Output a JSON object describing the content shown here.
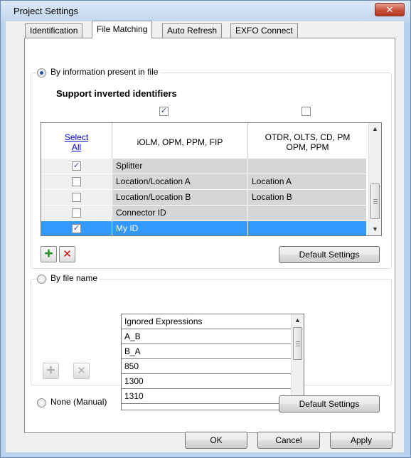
{
  "window": {
    "title": "Project Settings",
    "close_glyph": "✕"
  },
  "tabs": [
    {
      "label": "Identification",
      "active": false
    },
    {
      "label": "File Matching",
      "active": true
    },
    {
      "label": "Auto Refresh",
      "active": false
    },
    {
      "label": "EXFO Connect",
      "active": false
    }
  ],
  "by_info": {
    "label": "By information present in file",
    "selected": true,
    "support_inverted_label": "Support inverted identifiers",
    "support_inverted_col1_checked": true,
    "support_inverted_col2_checked": false
  },
  "grid": {
    "headers": {
      "select": "Select",
      "all": "All",
      "col1": "iOLM, OPM, PPM, FIP",
      "col2_line1": "OTDR, OLTS, CD, PM",
      "col2_line2": "OPM, PPM"
    },
    "rows": [
      {
        "checked": true,
        "col1": "Splitter",
        "col2": "",
        "selected": false
      },
      {
        "checked": false,
        "col1": "Location/Location A",
        "col2": "Location A",
        "selected": false
      },
      {
        "checked": false,
        "col1": "Location/Location B",
        "col2": "Location B",
        "selected": false
      },
      {
        "checked": false,
        "col1": "Connector ID",
        "col2": "",
        "selected": false
      },
      {
        "checked": true,
        "col1": "My ID",
        "col2": "",
        "selected": true
      }
    ],
    "scroll_up_glyph": "▲",
    "scroll_down_glyph": "▼"
  },
  "icons": {
    "add": "+",
    "remove": "✕",
    "check": "✓"
  },
  "default_settings_label": "Default Settings",
  "by_file_name": {
    "label": "By file name",
    "selected": false,
    "list_header": "Ignored Expressions",
    "items": [
      "A_B",
      "B_A",
      "850",
      "1300",
      "1310"
    ]
  },
  "none_manual": {
    "label": "None (Manual)",
    "selected": false
  },
  "footer": {
    "ok": "OK",
    "cancel": "Cancel",
    "apply": "Apply"
  },
  "colors": {
    "selection": "#3399ff",
    "remove_icon": "#d90000",
    "add_icon": "#1e8c1e",
    "link": "#0000d0"
  }
}
